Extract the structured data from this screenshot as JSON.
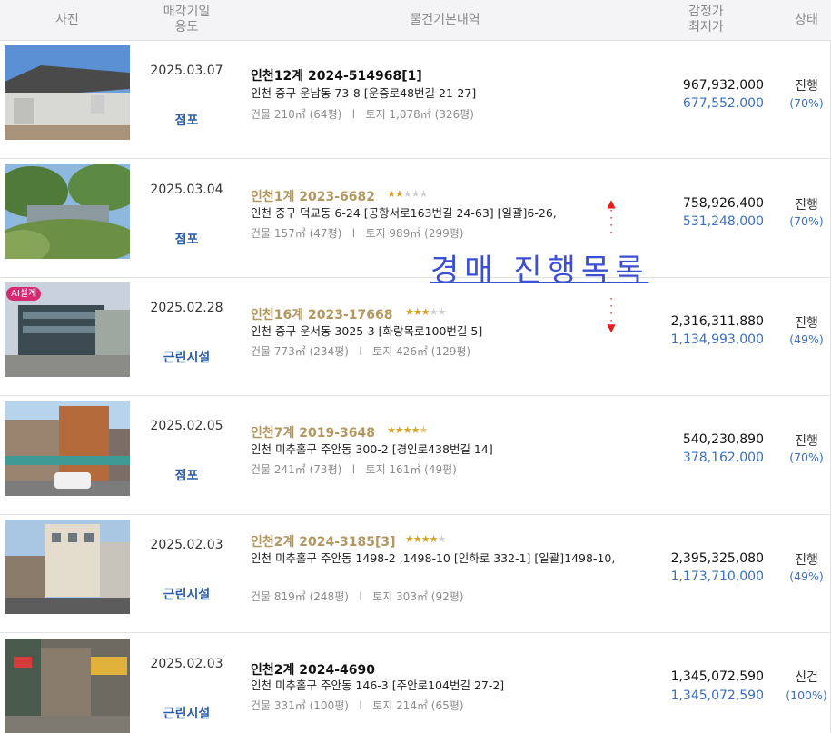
{
  "header": {
    "photo": "사진",
    "date_line1": "매각기일",
    "date_line2": "용도",
    "basic": "물건기본내역",
    "price_line1": "감정가",
    "price_line2": "최저가",
    "status": "상태"
  },
  "overlay": {
    "text": "경매 진행목록"
  },
  "rows": [
    {
      "date": "2025.03.07",
      "use": "점포",
      "case": "인천12계 2024-514968[1]",
      "stars_on": 0,
      "stars_total": 0,
      "address": "인천 중구 운남동 73-8 [운중로48번길 21-27]",
      "building": "건물 210㎡ (64평)",
      "land": "토지 1,078㎡ (326평)",
      "appraisal": "967,932,000",
      "minimum": "677,552,000",
      "status": "진행",
      "percent": "(70%)"
    },
    {
      "date": "2025.03.04",
      "use": "점포",
      "case": "인천1계 2023-6682",
      "stars_on": 2,
      "stars_total": 5,
      "address": "인천 중구 덕교동 6-24 [공항서로163번길 24-63] [일괄]6-26,",
      "building": "건물 157㎡ (47평)",
      "land": "토지 989㎡ (299평)",
      "appraisal": "758,926,400",
      "minimum": "531,248,000",
      "status": "진행",
      "percent": "(70%)"
    },
    {
      "date": "2025.02.28",
      "use": "근린시설",
      "case": "인천16계 2023-17668",
      "stars_on": 3,
      "stars_total": 5,
      "badge": "AI설계",
      "address": "인천 중구 운서동 3025-3 [화랑목로100번길 5]",
      "building": "건물 773㎡ (234평)",
      "land": "토지 426㎡ (129평)",
      "appraisal": "2,316,311,880",
      "minimum": "1,134,993,000",
      "status": "진행",
      "percent": "(49%)"
    },
    {
      "date": "2025.02.05",
      "use": "점포",
      "case": "인천7계 2019-3648",
      "stars_on": 4.5,
      "stars_total": 5,
      "address": "인천 미추홀구 주안동 300-2 [경인로438번길 14]",
      "building": "건물 241㎡ (73평)",
      "land": "토지 161㎡ (49평)",
      "appraisal": "540,230,890",
      "minimum": "378,162,000",
      "status": "진행",
      "percent": "(70%)"
    },
    {
      "date": "2025.02.03",
      "use": "근린시설",
      "case": "인천2계 2024-3185[3]",
      "stars_on": 4,
      "stars_total": 5,
      "address": "인천 미추홀구 주안동 1498-2 ,1498-10 [인하로 332-1] [일괄]1498-10,",
      "building": "건물 819㎡ (248평)",
      "land": "토지 303㎡ (92평)",
      "appraisal": "2,395,325,080",
      "minimum": "1,173,710,000",
      "status": "진행",
      "percent": "(49%)"
    },
    {
      "date": "2025.02.03",
      "use": "근린시설",
      "case": "인천2계 2024-4690",
      "stars_on": 0,
      "stars_total": 0,
      "address": "인천 미추홀구 주안동 146-3 [주안로104번길 27-2]",
      "building": "건물 331㎡ (100평)",
      "land": "토지 214㎡ (65평)",
      "appraisal": "1,345,072,590",
      "minimum": "1,345,072,590",
      "status": "신건",
      "percent": "(100%)"
    }
  ],
  "colors": {
    "accent_blue": "#3a6fc2",
    "gold_case": "#b39760",
    "star": "#d4a11e",
    "overlay": "#3b4fd4",
    "arrow": "#e81b1b"
  }
}
